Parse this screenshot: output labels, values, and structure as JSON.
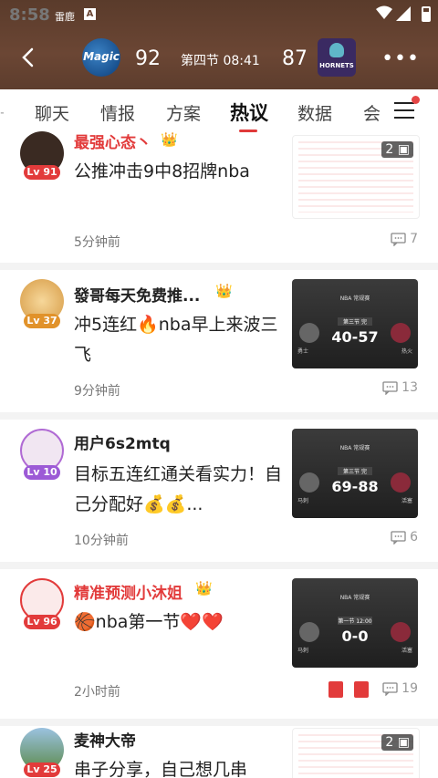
{
  "status": {
    "time": "8:58",
    "app": "雷鹿",
    "a_icon": "A"
  },
  "game": {
    "home_team": "Magic",
    "away_team": "HORNETS",
    "home_score": "92",
    "away_score": "87",
    "period": "第四节 08:41"
  },
  "tabs": [
    "聊天",
    "情报",
    "方案",
    "热议",
    "数据",
    "会"
  ],
  "active_tab": "热议",
  "posts": [
    {
      "name": "最强心态丶",
      "level": "Lv 91",
      "content": "公推冲击9中8招牌nba",
      "time": "5分钟前",
      "comments": "7",
      "img_count": "2"
    },
    {
      "name": "發哥每天免费推...",
      "level": "Lv 37",
      "content": "冲5连红🔥nba早上来波三飞",
      "time": "9分钟前",
      "comments": "13",
      "thumb": {
        "league": "NBA 常规赛",
        "period": "第三节 完",
        "score": "40-57",
        "left": "勇士",
        "right": "热火"
      }
    },
    {
      "name": "用户6s2mtq",
      "level": "Lv 10",
      "content": "目标五连红通关看实力！自己分配好💰💰...",
      "time": "10分钟前",
      "comments": "6",
      "thumb": {
        "league": "NBA 常规赛",
        "period": "第三节 完",
        "score": "69-88",
        "left": "马刺",
        "right": "活塞"
      }
    },
    {
      "name": "精准预测小沐姐",
      "level": "Lv 96",
      "content": "🏀nba第一节❤️❤️",
      "time": "2小时前",
      "comments": "19",
      "thumb": {
        "league": "NBA 常规赛",
        "period": "第一节 12:00",
        "score": "0-0",
        "left": "马刺",
        "right": "活塞"
      }
    },
    {
      "name": "麦神大帝",
      "level": "Lv 25",
      "content": "串子分享，自己想几串",
      "img_count": "2"
    }
  ]
}
